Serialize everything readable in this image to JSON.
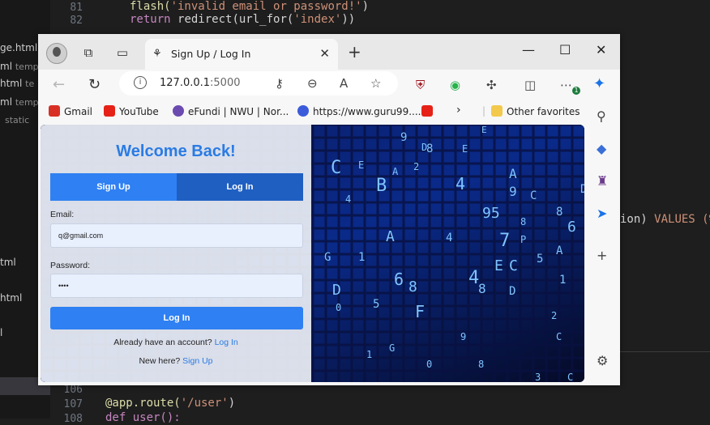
{
  "editor": {
    "explorer_items": [
      {
        "name": "ge.html",
        "suffix": ""
      },
      {
        "name": "ml",
        "suffix": "temp"
      },
      {
        "name": "html",
        "suffix": "te"
      },
      {
        "name": "ml",
        "suffix": "templ"
      },
      {
        "name": "static",
        "suffix": ""
      },
      {
        "name": "tml",
        "suffix": ""
      },
      {
        "name": "html",
        "suffix": ""
      },
      {
        "name": "l",
        "suffix": ""
      }
    ],
    "lines": [
      {
        "num": "81",
        "indent": "    ",
        "parts": [
          {
            "t": "flash(",
            "c": "fn"
          },
          {
            "t": "'invalid email or password!'",
            "c": "str"
          },
          {
            "t": ")",
            "c": ""
          }
        ]
      },
      {
        "num": "82",
        "indent": "    ",
        "parts": [
          {
            "t": "return ",
            "c": "kw"
          },
          {
            "t": "redirect(url_for(",
            "c": ""
          },
          {
            "t": "'index'",
            "c": "str"
          },
          {
            "t": "))",
            "c": ""
          }
        ]
      },
      {
        "num": "106",
        "indent": "",
        "parts": []
      },
      {
        "num": "107",
        "indent": "",
        "parts": [
          {
            "t": "@app.route(",
            "c": "dec"
          },
          {
            "t": "'/user'",
            "c": "str"
          },
          {
            "t": ")",
            "c": ""
          }
        ]
      },
      {
        "num": "108",
        "indent": "",
        "parts": [
          {
            "t": "def user():",
            "c": ""
          }
        ]
      }
    ],
    "right_fragment_a": "ion) ",
    "right_fragment_b": "VALUES (%"
  },
  "browser": {
    "tab_title": "Sign Up / Log In",
    "address": "127.0.0.1",
    "address_port": ":5000",
    "ext_badge": "1",
    "favorites": [
      {
        "label": "Gmail",
        "color": "#d93025"
      },
      {
        "label": "YouTube",
        "color": "#e62117"
      },
      {
        "label": "eFundi | NWU | Nor...",
        "color": "#6b4bb0"
      },
      {
        "label": "https://www.guru99....",
        "color": "#3b5bdb"
      }
    ],
    "other_favorites": "Other favorites"
  },
  "page": {
    "heading": "Welcome Back!",
    "tab_signup": "Sign Up",
    "tab_login": "Log In",
    "email_label": "Email:",
    "email_value": "q@gmail.com",
    "password_label": "Password:",
    "password_value": "••••",
    "submit_label": "Log In",
    "have_account_text": "Already have an account?",
    "have_account_link": "Log In",
    "new_here_text": "New here?",
    "new_here_link": "Sign Up"
  },
  "colors": {
    "accent": "#2a7be4",
    "tab_signup_bg": "#2f80f2",
    "tab_login_bg": "#1f5fc2",
    "matrix_bg": "#0a1030"
  }
}
